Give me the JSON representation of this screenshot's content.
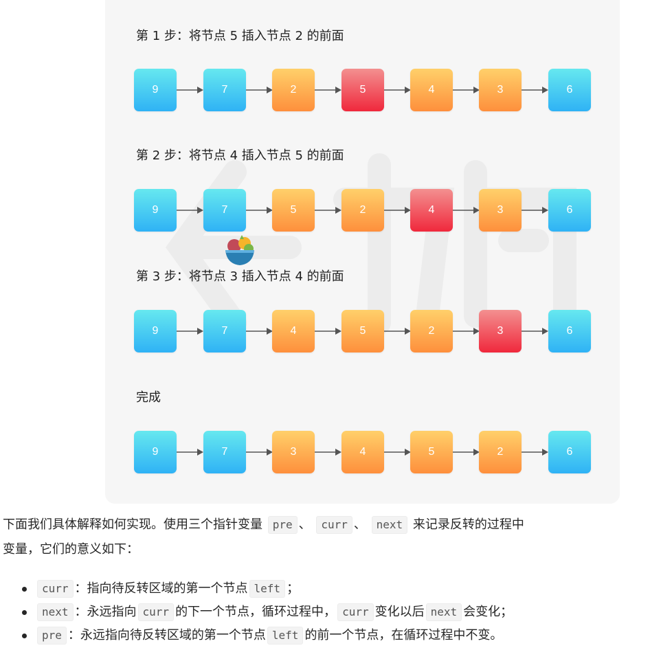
{
  "steps": [
    {
      "title": "第 1 步：将节点 5 插入节点 2 的前面",
      "nodes": [
        {
          "value": "9",
          "color": "blue"
        },
        {
          "value": "7",
          "color": "blue"
        },
        {
          "value": "2",
          "color": "orange"
        },
        {
          "value": "5",
          "color": "red"
        },
        {
          "value": "4",
          "color": "orange"
        },
        {
          "value": "3",
          "color": "orange"
        },
        {
          "value": "6",
          "color": "blue"
        }
      ]
    },
    {
      "title": "第 2 步：将节点 4 插入节点 5 的前面",
      "nodes": [
        {
          "value": "9",
          "color": "blue"
        },
        {
          "value": "7",
          "color": "blue"
        },
        {
          "value": "5",
          "color": "orange"
        },
        {
          "value": "2",
          "color": "orange"
        },
        {
          "value": "4",
          "color": "red"
        },
        {
          "value": "3",
          "color": "orange"
        },
        {
          "value": "6",
          "color": "blue"
        }
      ]
    },
    {
      "title": "第 3 步：将节点 3 插入节点 4 的前面",
      "nodes": [
        {
          "value": "9",
          "color": "blue"
        },
        {
          "value": "7",
          "color": "blue"
        },
        {
          "value": "4",
          "color": "orange"
        },
        {
          "value": "5",
          "color": "orange"
        },
        {
          "value": "2",
          "color": "orange"
        },
        {
          "value": "3",
          "color": "red"
        },
        {
          "value": "6",
          "color": "blue"
        }
      ]
    },
    {
      "title": "完成",
      "nodes": [
        {
          "value": "9",
          "color": "blue"
        },
        {
          "value": "7",
          "color": "blue"
        },
        {
          "value": "3",
          "color": "orange"
        },
        {
          "value": "4",
          "color": "orange"
        },
        {
          "value": "5",
          "color": "orange"
        },
        {
          "value": "2",
          "color": "orange"
        },
        {
          "value": "6",
          "color": "blue"
        }
      ]
    }
  ],
  "colors": {
    "blue": "#2fb2f5",
    "orange": "#fe8f3c",
    "red": "#f0283c",
    "arrow": "#555555"
  },
  "paragraph": {
    "part1": "下面我们具体解释如何实现。使用三个指针变量",
    "code1": "pre",
    "sep1": "、",
    "code2": "curr",
    "sep2": "、",
    "code3": "next",
    "part2": "来记录反转的过程中",
    "line2": "变量，它们的意义如下："
  },
  "bullets": [
    {
      "segments": [
        {
          "code": "curr"
        },
        {
          "text": "：指向待反转区域的第一个节点"
        },
        {
          "code": "left"
        },
        {
          "text": "；"
        }
      ]
    },
    {
      "segments": [
        {
          "code": "next"
        },
        {
          "text": "：永远指向"
        },
        {
          "code": "curr"
        },
        {
          "text": "的下一个节点，循环过程中，"
        },
        {
          "code": "curr"
        },
        {
          "text": "变化以后"
        },
        {
          "code": "next"
        },
        {
          "text": "会变化；"
        }
      ]
    },
    {
      "segments": [
        {
          "code": "pre"
        },
        {
          "text": "：永远指向待反转区域的第一个节点"
        },
        {
          "code": "left"
        },
        {
          "text": "的前一个节点，在循环过程中不变。"
        }
      ]
    }
  ]
}
